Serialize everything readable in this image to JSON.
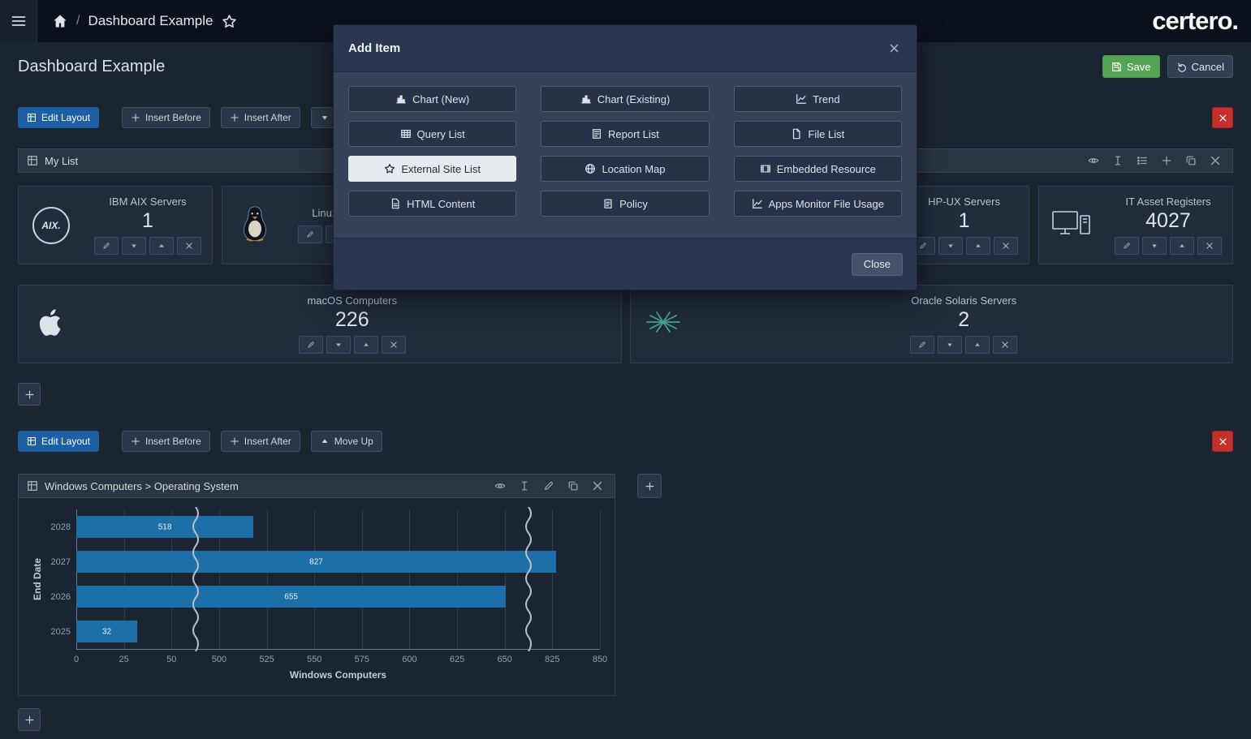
{
  "topbar": {
    "breadcrumb_separator": "/",
    "title": "Dashboard Example",
    "logo": "certero."
  },
  "page_header": {
    "title": "Dashboard Example",
    "save": "Save",
    "cancel": "Cancel"
  },
  "modal": {
    "title": "Add Item",
    "close_button": "Close",
    "items": [
      {
        "label": "Chart (New)",
        "icon": "chart-bar",
        "highlighted": false
      },
      {
        "label": "Chart (Existing)",
        "icon": "chart-bar",
        "highlighted": false
      },
      {
        "label": "Trend",
        "icon": "chart-line",
        "highlighted": false
      },
      {
        "label": "Query List",
        "icon": "table",
        "highlighted": false
      },
      {
        "label": "Report List",
        "icon": "report",
        "highlighted": false
      },
      {
        "label": "File List",
        "icon": "file",
        "highlighted": false
      },
      {
        "label": "External Site List",
        "icon": "star",
        "highlighted": true
      },
      {
        "label": "Location Map",
        "icon": "globe",
        "highlighted": false
      },
      {
        "label": "Embedded Resource",
        "icon": "film",
        "highlighted": false
      },
      {
        "label": "HTML Content",
        "icon": "document",
        "highlighted": false
      },
      {
        "label": "Policy",
        "icon": "policy",
        "highlighted": false
      },
      {
        "label": "Apps Monitor File Usage",
        "icon": "chart-line",
        "highlighted": false
      }
    ]
  },
  "section_top": {
    "edit_layout": "Edit Layout",
    "insert_before": "Insert Before",
    "insert_after": "Insert After",
    "move_down": "Move Down",
    "panel_title": "My List"
  },
  "cards": {
    "ibm_aix": {
      "title": "IBM AIX Servers",
      "value": "1",
      "logo": "aix-circle",
      "logo_text": "AIX."
    },
    "linux": {
      "title": "Linux Computers",
      "value": "",
      "logo": "tux-penguin"
    },
    "hp_ux": {
      "title": "HP-UX Servers",
      "value": "1",
      "logo": ""
    },
    "it_asset_registers": {
      "title": "IT Asset Registers",
      "value": "4027",
      "logo": "monitor"
    },
    "macos": {
      "title": "macOS Computers",
      "value": "226",
      "logo": "apple"
    },
    "oracle_solaris": {
      "title": "Oracle Solaris Servers",
      "value": "2",
      "logo": "sun-burst"
    }
  },
  "section_bottom": {
    "edit_layout": "Edit Layout",
    "insert_before": "Insert Before",
    "insert_after": "Insert After",
    "move_up": "Move Up",
    "panel_title": "Windows Computers > Operating System"
  },
  "chart_data": {
    "type": "bar",
    "orientation": "horizontal",
    "title": "Windows Computers > Operating System",
    "categories": [
      "2028",
      "2027",
      "2026",
      "2025"
    ],
    "values": [
      518,
      827,
      655,
      32
    ],
    "xlabel": "Windows Computers",
    "ylabel": "End Date",
    "x_ticks": [
      0,
      25,
      50,
      500,
      525,
      550,
      575,
      600,
      625,
      650,
      825,
      850
    ],
    "axis_breaks_between_ticks": [
      [
        2,
        3
      ],
      [
        9,
        10
      ]
    ],
    "bar_color": "#1d6fa8",
    "bar_labels": true,
    "grid": true,
    "legend": false
  },
  "colors": {
    "accent_blue": "#1d5fa3",
    "save_green": "#55a455",
    "danger_red": "#c5302b",
    "bar_blue": "#1d6fa8",
    "modal_highlight": "#e7eaee"
  }
}
